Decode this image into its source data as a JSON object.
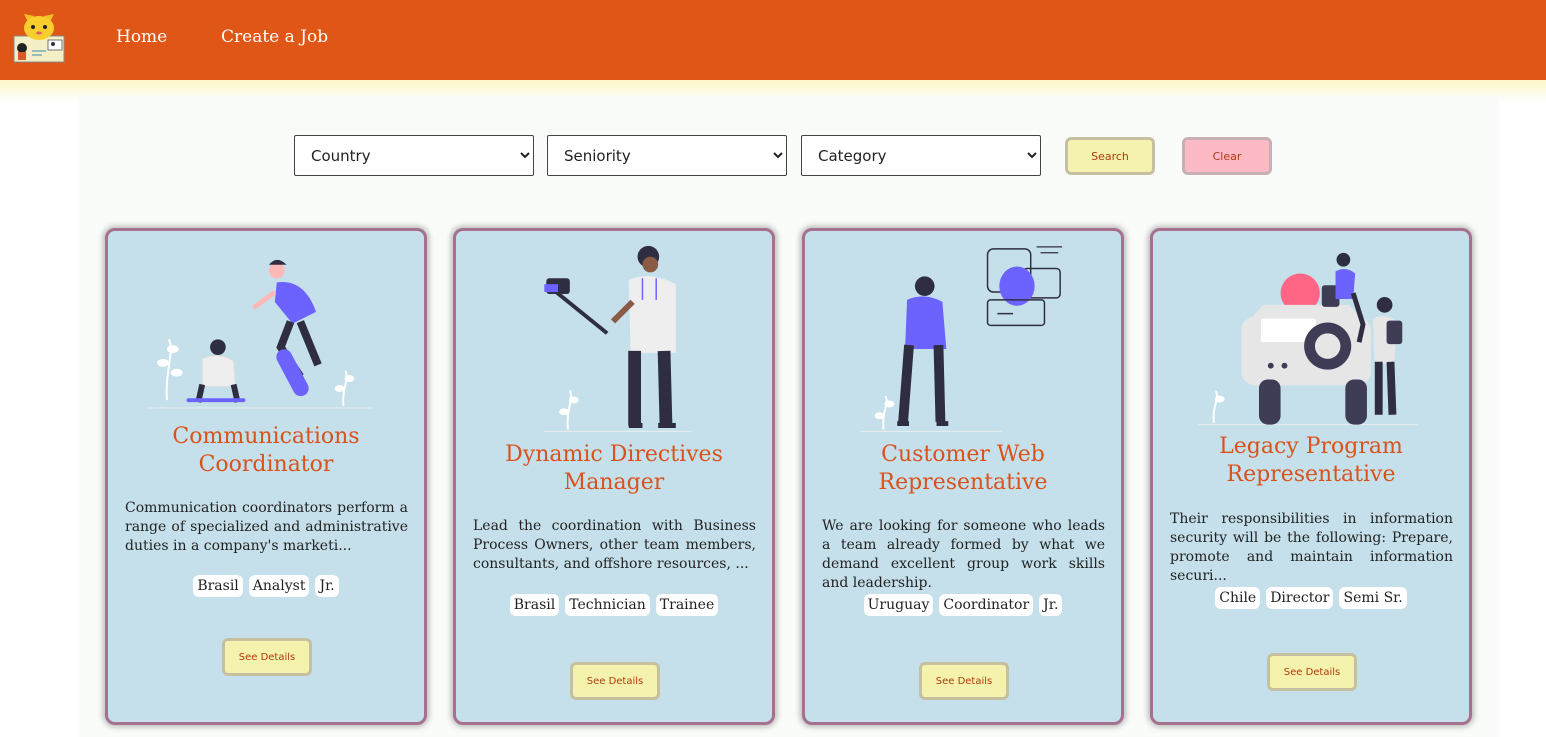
{
  "nav": {
    "home": "Home",
    "create_job": "Create a Job"
  },
  "filters": {
    "country": "Country",
    "seniority": "Seniority",
    "category": "Category"
  },
  "buttons": {
    "search": "Search",
    "clear": "Clear"
  },
  "colors": {
    "header": "#df5617",
    "card_bg": "#c5e0ea",
    "accent_title": "#d9521c",
    "illustration_purple": "#6c63ff"
  },
  "jobs": [
    {
      "title": "Communications Coordinator",
      "description": "Communication coordinators perform a range of specialized and administrative duties in a company's marketi...",
      "tags": [
        "Brasil",
        "Analyst",
        "Jr."
      ],
      "details_label": "See Details"
    },
    {
      "title": "Dynamic Directives Manager",
      "description": "Lead the coordination with Business Process Owners, other team members, consultants, and offshore resources, ...",
      "tags": [
        "Brasil",
        "Technician",
        "Trainee"
      ],
      "details_label": "See Details"
    },
    {
      "title": "Customer Web Representative",
      "description": "We are looking for someone who leads a team already formed by what we demand excellent group work skills and leadership.",
      "tags": [
        "Uruguay",
        "Coordinator",
        "Jr."
      ],
      "details_label": "See Details"
    },
    {
      "title": "Legacy Program Representative",
      "description": "Their responsibilities in information security will be the following: Prepare, promote and maintain information securi...",
      "tags": [
        "Chile",
        "Director",
        "Semi Sr."
      ],
      "details_label": "See Details"
    }
  ]
}
